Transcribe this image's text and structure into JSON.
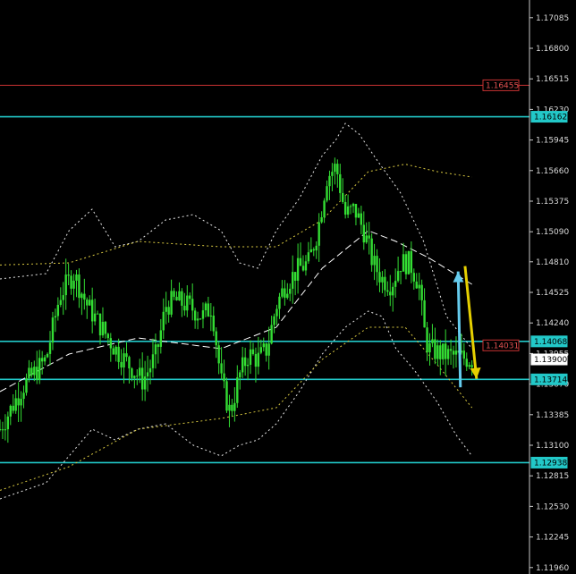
{
  "colors": {
    "background": "#000000",
    "axis": "#c8c8c8",
    "candle": "#33dd33",
    "level_line": "#22c8c8",
    "resistance_line": "#c83232",
    "bollinger": "#e6e6e6",
    "arrow_up": "#66ccee",
    "arrow_down": "#e6d000"
  },
  "chart_data": {
    "type": "candlestick",
    "instrument": "",
    "ylim": [
      1.119,
      1.1725
    ],
    "y_ticks": [
      "1.17085",
      "1.16800",
      "1.16515",
      "1.16230",
      "1.15945",
      "1.15660",
      "1.15375",
      "1.15090",
      "1.14810",
      "1.14525",
      "1.14240",
      "1.13955",
      "1.13670",
      "1.13385",
      "1.13100",
      "1.12815",
      "1.12530",
      "1.12245",
      "1.11960"
    ],
    "horizontal_levels": [
      {
        "id": "lvl_16455",
        "value": 1.16455,
        "label": "1.16455",
        "kind": "resistance"
      },
      {
        "id": "lvl_16162",
        "value": 1.16162,
        "label": "1.16162",
        "kind": "level"
      },
      {
        "id": "lvl_14068",
        "value": 1.14068,
        "label": "1.14068",
        "kind": "level"
      },
      {
        "id": "lvl_13714",
        "value": 1.13714,
        "label": "1.13714",
        "kind": "level"
      },
      {
        "id": "lvl_12938",
        "value": 1.12938,
        "label": "1.12938",
        "kind": "level"
      }
    ],
    "price_tags": [
      {
        "label": "1.14031",
        "value": 1.14031,
        "kind": "red"
      },
      {
        "label": "1.13900",
        "value": 1.139,
        "kind": "current"
      }
    ],
    "n_bars": 180,
    "close_path": [
      [
        0,
        1.1325
      ],
      [
        10,
        1.1365
      ],
      [
        20,
        1.139
      ],
      [
        26,
        1.145
      ],
      [
        32,
        1.147
      ],
      [
        38,
        1.144
      ],
      [
        44,
        1.142
      ],
      [
        50,
        1.14
      ],
      [
        56,
        1.1385
      ],
      [
        62,
        1.137
      ],
      [
        68,
        1.1395
      ],
      [
        72,
        1.144
      ],
      [
        76,
        1.1445
      ],
      [
        82,
        1.144
      ],
      [
        88,
        1.143
      ],
      [
        92,
        1.144
      ],
      [
        96,
        1.137
      ],
      [
        100,
        1.134
      ],
      [
        104,
        1.1375
      ],
      [
        108,
        1.1395
      ],
      [
        112,
        1.139
      ],
      [
        116,
        1.14
      ],
      [
        120,
        1.144
      ],
      [
        124,
        1.146
      ],
      [
        130,
        1.1475
      ],
      [
        134,
        1.148
      ],
      [
        138,
        1.151
      ],
      [
        142,
        1.156
      ],
      [
        146,
        1.157
      ],
      [
        150,
        1.1525
      ],
      [
        154,
        1.153
      ],
      [
        158,
        1.151
      ],
      [
        162,
        1.148
      ],
      [
        166,
        1.1465
      ],
      [
        170,
        1.146
      ],
      [
        174,
        1.148
      ],
      [
        178,
        1.148
      ],
      [
        182,
        1.146
      ],
      [
        184,
        1.142
      ],
      [
        186,
        1.14
      ],
      [
        192,
        1.1395
      ],
      [
        200,
        1.1392
      ],
      [
        205,
        1.139
      ]
    ],
    "bollinger_outer_upper": [
      [
        0,
        1.1465
      ],
      [
        20,
        1.147
      ],
      [
        30,
        1.151
      ],
      [
        40,
        1.153
      ],
      [
        50,
        1.1495
      ],
      [
        60,
        1.15
      ],
      [
        72,
        1.152
      ],
      [
        84,
        1.1525
      ],
      [
        96,
        1.151
      ],
      [
        104,
        1.148
      ],
      [
        112,
        1.1475
      ],
      [
        120,
        1.151
      ],
      [
        130,
        1.154
      ],
      [
        140,
        1.158
      ],
      [
        146,
        1.1595
      ],
      [
        150,
        1.161
      ],
      [
        156,
        1.16
      ],
      [
        164,
        1.1575
      ],
      [
        174,
        1.1545
      ],
      [
        184,
        1.15
      ],
      [
        194,
        1.143
      ],
      [
        205,
        1.14
      ]
    ],
    "bollinger_outer_lower": [
      [
        0,
        1.126
      ],
      [
        20,
        1.1275
      ],
      [
        30,
        1.13
      ],
      [
        40,
        1.1325
      ],
      [
        50,
        1.1315
      ],
      [
        60,
        1.1325
      ],
      [
        72,
        1.133
      ],
      [
        84,
        1.131
      ],
      [
        96,
        1.13
      ],
      [
        104,
        1.131
      ],
      [
        112,
        1.1315
      ],
      [
        120,
        1.133
      ],
      [
        130,
        1.136
      ],
      [
        140,
        1.1395
      ],
      [
        150,
        1.142
      ],
      [
        160,
        1.1435
      ],
      [
        166,
        1.143
      ],
      [
        172,
        1.14
      ],
      [
        180,
        1.138
      ],
      [
        190,
        1.135
      ],
      [
        198,
        1.132
      ],
      [
        205,
        1.13
      ]
    ],
    "bollinger_mid": [
      [
        0,
        1.136
      ],
      [
        30,
        1.1395
      ],
      [
        60,
        1.141
      ],
      [
        96,
        1.14
      ],
      [
        120,
        1.142
      ],
      [
        140,
        1.1475
      ],
      [
        160,
        1.151
      ],
      [
        172,
        1.15
      ],
      [
        186,
        1.1485
      ],
      [
        205,
        1.146
      ]
    ],
    "yellow_ma_upper": [
      [
        0,
        1.1478
      ],
      [
        30,
        1.148
      ],
      [
        60,
        1.15
      ],
      [
        96,
        1.1495
      ],
      [
        120,
        1.1495
      ],
      [
        140,
        1.152
      ],
      [
        160,
        1.1565
      ],
      [
        176,
        1.1572
      ],
      [
        190,
        1.1565
      ],
      [
        205,
        1.156
      ]
    ],
    "yellow_ma_lower": [
      [
        0,
        1.1268
      ],
      [
        30,
        1.129
      ],
      [
        60,
        1.1325
      ],
      [
        96,
        1.1335
      ],
      [
        120,
        1.1345
      ],
      [
        140,
        1.139
      ],
      [
        160,
        1.142
      ],
      [
        176,
        1.142
      ],
      [
        190,
        1.1385
      ],
      [
        205,
        1.1345
      ]
    ],
    "arrows": [
      {
        "id": "arrow_up",
        "x0": 200,
        "y0": 1.1364,
        "x1": 199,
        "y1": 1.1472,
        "color_key": "arrow_up"
      },
      {
        "id": "arrow_down",
        "x0": 202,
        "y0": 1.1477,
        "x1": 207,
        "y1": 1.1372,
        "color_key": "arrow_down"
      }
    ]
  }
}
